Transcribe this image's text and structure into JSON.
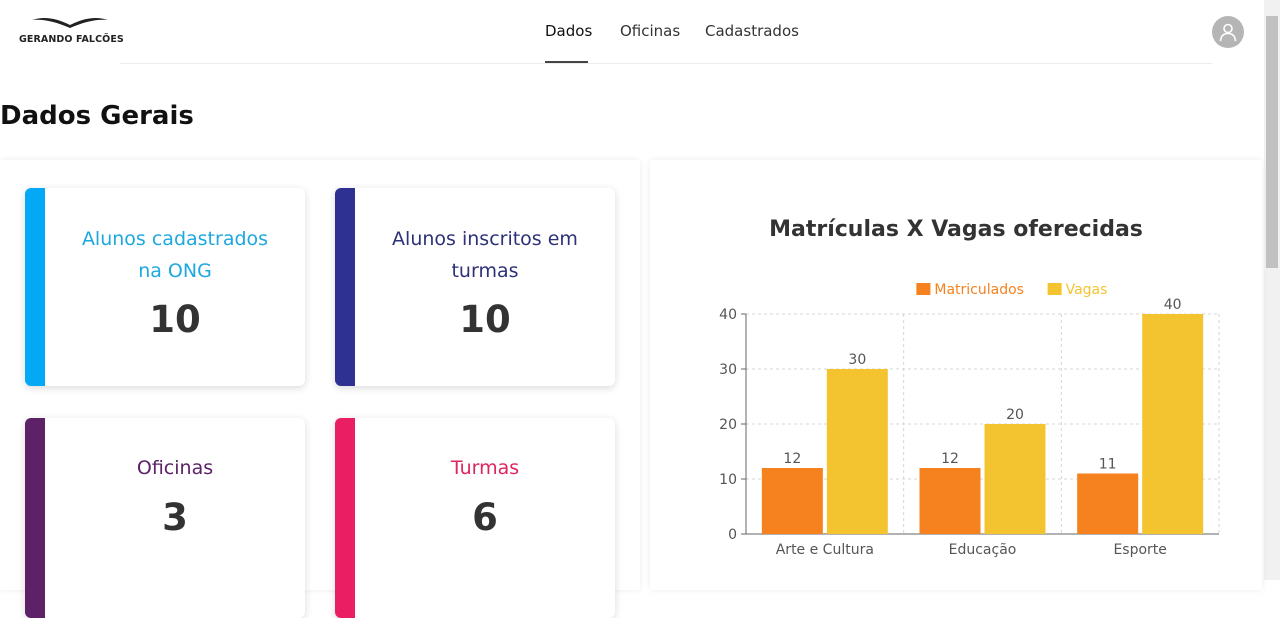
{
  "brand": {
    "name": "GERANDO FALCÕES",
    "icon": "falcon-wings-logo"
  },
  "nav": {
    "tabs": [
      "Dados",
      "Oficinas",
      "Cadastrados"
    ],
    "active": "Dados"
  },
  "page": {
    "title": "Dados Gerais"
  },
  "cards": [
    {
      "label_line1": "Alunos cadastrados",
      "label_line2": "na ONG",
      "value": "10",
      "color": "#03a9f4"
    },
    {
      "label_line1": "Alunos inscritos em",
      "label_line2": "turmas",
      "value": "10",
      "color": "#2e3192"
    },
    {
      "label_line1": "Oficinas",
      "value": "3",
      "color": "#5c2166"
    },
    {
      "label_line1": "Turmas",
      "value": "6",
      "color": "#e91e63"
    }
  ],
  "chart_data": {
    "type": "bar",
    "title": "Matrículas X Vagas oferecidas",
    "categories": [
      "Arte e Cultura",
      "Educação",
      "Esporte"
    ],
    "series": [
      {
        "name": "Matriculados",
        "values": [
          12,
          12,
          11
        ],
        "color": "#f5821f"
      },
      {
        "name": "Vagas",
        "values": [
          30,
          20,
          40
        ],
        "color": "#f4c430"
      }
    ],
    "yticks": [
      "0",
      "10",
      "20",
      "30",
      "40"
    ],
    "ylim": [
      0,
      40
    ],
    "grid": true,
    "legend": "top"
  }
}
